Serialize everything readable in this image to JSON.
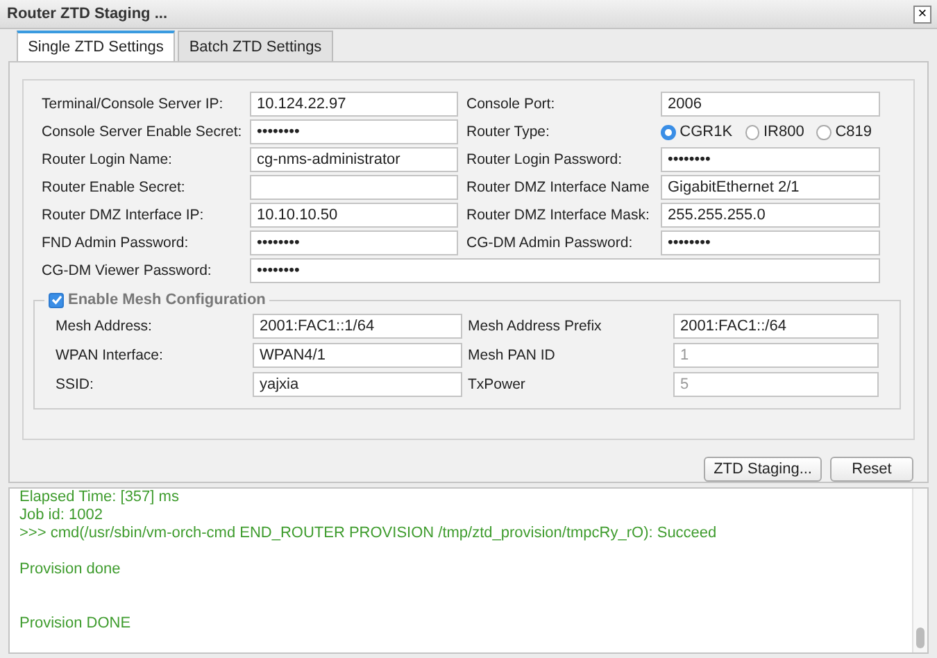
{
  "window": {
    "title": "Router ZTD Staging ...",
    "close": "×"
  },
  "tabs": [
    {
      "label": "Single ZTD Settings",
      "selected": true
    },
    {
      "label": "Batch ZTD Settings",
      "selected": false
    }
  ],
  "form": {
    "fields": [
      {
        "label": "Terminal/Console Server IP:",
        "kind": "text",
        "value": "10.124.22.97"
      },
      {
        "label": "Console Port:",
        "kind": "text",
        "value": "2006"
      },
      {
        "label": "Console Server Enable Secret:",
        "kind": "text",
        "value": "••••••••"
      },
      {
        "label": "Router Type:",
        "kind": "radio",
        "options": [
          {
            "label": "CGR1K",
            "selected": true
          },
          {
            "label": "IR800",
            "selected": false
          },
          {
            "label": "C819",
            "selected": false
          }
        ]
      },
      {
        "label": "Router Login Name:",
        "kind": "text",
        "value": "cg-nms-administrator"
      },
      {
        "label": "Router Login Password:",
        "kind": "text",
        "value": "••••••••"
      },
      {
        "label": "Router Enable Secret:",
        "kind": "text"
      },
      {
        "label": "Router DMZ Interface Name",
        "kind": "text",
        "value": "GigabitEthernet 2/1"
      },
      {
        "label": "Router DMZ Interface IP:",
        "kind": "text",
        "value": "10.10.10.50"
      },
      {
        "label": "Router DMZ Interface Mask:",
        "kind": "text",
        "value": "255.255.255.0"
      },
      {
        "label": "FND Admin Password:",
        "kind": "text",
        "value": "••••••••"
      },
      {
        "label": "CG-DM Admin Password:",
        "kind": "text",
        "value": "••••••••"
      },
      {
        "label": "CG-DM Viewer Password:",
        "kind": "wide",
        "value": "••••••••"
      }
    ]
  },
  "mesh": {
    "label": "Enable Mesh Configuration",
    "checked": true,
    "fields": [
      {
        "label": "Mesh Address:",
        "value": "2001:FAC1::1/64",
        "disabled": false
      },
      {
        "label": "Mesh Address Prefix",
        "value": "2001:FAC1::/64",
        "disabled": false
      },
      {
        "label": "WPAN Interface:",
        "value": "WPAN4/1",
        "disabled": false
      },
      {
        "label": "Mesh PAN ID",
        "value": "1",
        "disabled": true
      },
      {
        "label": "SSID:",
        "value": "yajxia",
        "disabled": false
      },
      {
        "label": "TxPower",
        "value": "5",
        "disabled": true
      }
    ]
  },
  "buttons": [
    "ZTD Staging...",
    "Reset"
  ],
  "log": [
    {
      "kind": "line",
      "text": "Elapsed Time: [357] ms"
    },
    {
      "kind": "line",
      "text": "Job id: 1002"
    },
    {
      "kind": "line",
      "text": ">>> cmd(/usr/sbin/vm-orch-cmd END_ROUTER PROVISION /tmp/ztd_provision/tmpcRy_rO): Succeed"
    },
    {
      "kind": "blank"
    },
    {
      "kind": "line",
      "text": "Provision done"
    },
    {
      "kind": "blank"
    },
    {
      "kind": "blank"
    },
    {
      "kind": "line",
      "text": "Provision DONE"
    }
  ]
}
